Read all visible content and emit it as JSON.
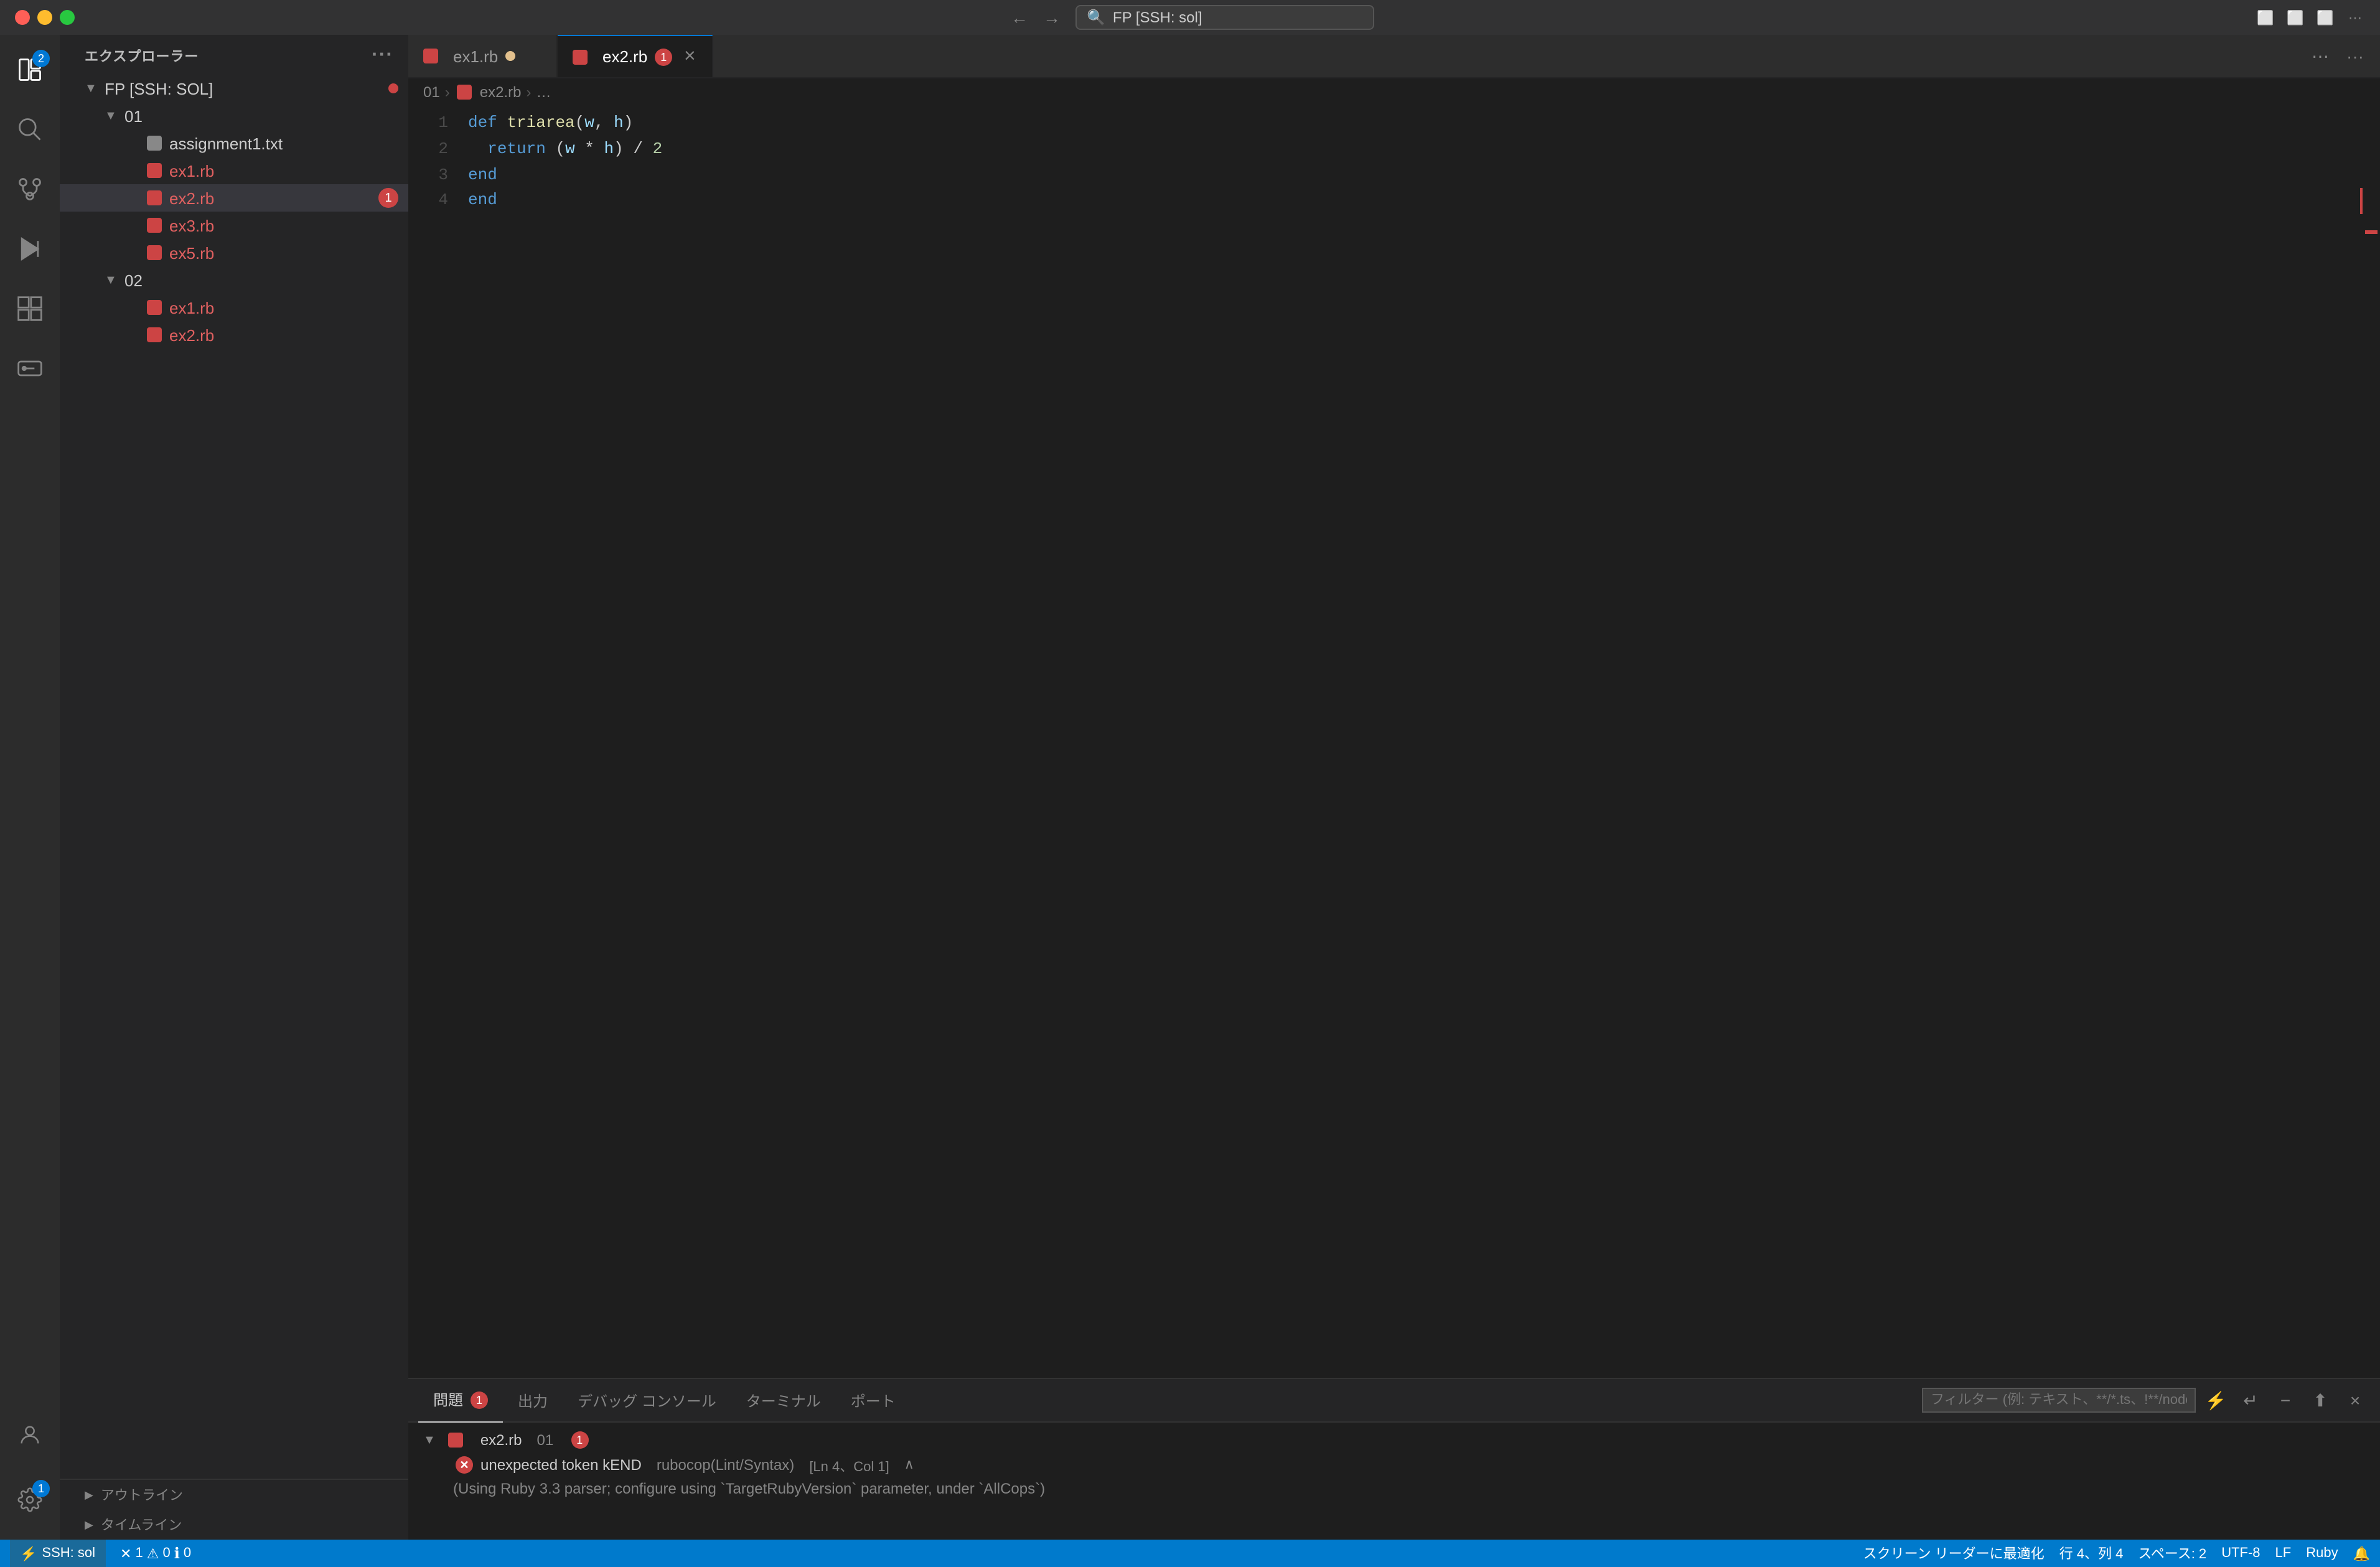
{
  "titleBar": {
    "searchText": "FP [SSH: sol]",
    "navBack": "←",
    "navForward": "→"
  },
  "activityBar": {
    "items": [
      {
        "name": "explorer",
        "icon": "⊞",
        "badge": "2",
        "active": true
      },
      {
        "name": "search",
        "icon": "🔍",
        "badge": null
      },
      {
        "name": "source-control",
        "icon": "⎇",
        "badge": null
      },
      {
        "name": "run",
        "icon": "▷",
        "badge": null
      },
      {
        "name": "extensions",
        "icon": "⊞",
        "badge": null
      },
      {
        "name": "remote-explorer",
        "icon": "🖥",
        "badge": null
      }
    ],
    "bottomItems": [
      {
        "name": "account",
        "icon": "👤"
      },
      {
        "name": "settings",
        "icon": "⚙",
        "badge": "1"
      }
    ]
  },
  "sidebar": {
    "title": "エクスプローラー",
    "moreIcon": "···",
    "root": "FP [SSH: SOL]",
    "tree": [
      {
        "type": "folder",
        "label": "01",
        "open": true,
        "indent": 1
      },
      {
        "type": "file",
        "label": "assignment1.txt",
        "ext": "txt",
        "indent": 2,
        "error": false
      },
      {
        "type": "file",
        "label": "ex1.rb",
        "ext": "rb",
        "indent": 2,
        "error": false
      },
      {
        "type": "file",
        "label": "ex2.rb",
        "ext": "rb",
        "indent": 2,
        "error": true,
        "badge": "1",
        "active": true
      },
      {
        "type": "file",
        "label": "ex3.rb",
        "ext": "rb",
        "indent": 2,
        "error": false
      },
      {
        "type": "file",
        "label": "ex5.rb",
        "ext": "rb",
        "indent": 2,
        "error": false
      },
      {
        "type": "folder",
        "label": "02",
        "open": true,
        "indent": 1
      },
      {
        "type": "file",
        "label": "ex1.rb",
        "ext": "rb",
        "indent": 2,
        "error": false
      },
      {
        "type": "file",
        "label": "ex2.rb",
        "ext": "rb",
        "indent": 2,
        "error": false
      }
    ],
    "bottomSections": [
      {
        "label": "アウトライン"
      },
      {
        "label": "タイムライン"
      }
    ]
  },
  "tabs": [
    {
      "label": "ex1.rb",
      "ext": "rb",
      "active": false,
      "unsaved": true,
      "badge": null
    },
    {
      "label": "ex2.rb",
      "ext": "rb",
      "active": true,
      "unsaved": false,
      "badge": "1"
    }
  ],
  "breadcrumb": {
    "parts": [
      "01",
      "ex2.rb",
      "..."
    ]
  },
  "code": {
    "lines": [
      {
        "num": 1,
        "content": "def triarea(w, h)",
        "tokens": [
          {
            "text": "def ",
            "cls": "kw"
          },
          {
            "text": "triarea",
            "cls": "fn"
          },
          {
            "text": "(",
            "cls": "op"
          },
          {
            "text": "w",
            "cls": "param"
          },
          {
            "text": ", ",
            "cls": "op"
          },
          {
            "text": "h",
            "cls": "param"
          },
          {
            "text": ")",
            "cls": "op"
          }
        ]
      },
      {
        "num": 2,
        "content": "  return (w * h) / 2",
        "tokens": [
          {
            "text": "  ",
            "cls": ""
          },
          {
            "text": "return ",
            "cls": "kw"
          },
          {
            "text": "(",
            "cls": "op"
          },
          {
            "text": "w",
            "cls": "param"
          },
          {
            "text": " * ",
            "cls": "op"
          },
          {
            "text": "h",
            "cls": "param"
          },
          {
            "text": ") / ",
            "cls": "op"
          },
          {
            "text": "2",
            "cls": "num"
          }
        ]
      },
      {
        "num": 3,
        "content": "end",
        "tokens": [
          {
            "text": "end",
            "cls": "kw"
          }
        ]
      },
      {
        "num": 4,
        "content": "end",
        "tokens": [
          {
            "text": "end",
            "cls": "kw"
          }
        ],
        "error": true
      }
    ]
  },
  "panel": {
    "tabs": [
      {
        "label": "問題",
        "badge": "1",
        "active": true
      },
      {
        "label": "出力",
        "badge": null,
        "active": false
      },
      {
        "label": "デバッグ コンソール",
        "badge": null,
        "active": false
      },
      {
        "label": "ターミナル",
        "badge": null,
        "active": false
      },
      {
        "label": "ポート",
        "badge": null,
        "active": false
      }
    ],
    "filterPlaceholder": "フィルター (例: テキスト、**/*.ts、!**/node_modules/**)",
    "sourceFile": "ex2.rb",
    "sourceFolder": "01",
    "sourceBadge": "1",
    "errors": [
      {
        "text": "unexpected token kEND",
        "detail": "rubocop(Lint/Syntax)",
        "location": "[Ln 4、Col 1]",
        "subtext": "(Using Ruby 3.3 parser; configure using `TargetRubyVersion` parameter, under `AllCops`)"
      }
    ]
  },
  "statusBar": {
    "ssh": "SSH: sol",
    "errors": "1",
    "warnings": "0",
    "infos": "0",
    "position": "行 4、列 4",
    "spaces": "スペース: 2",
    "encoding": "UTF-8",
    "lineEnding": "LF",
    "language": "Ruby",
    "screenReader": "スクリーン リーダーに最適化"
  }
}
